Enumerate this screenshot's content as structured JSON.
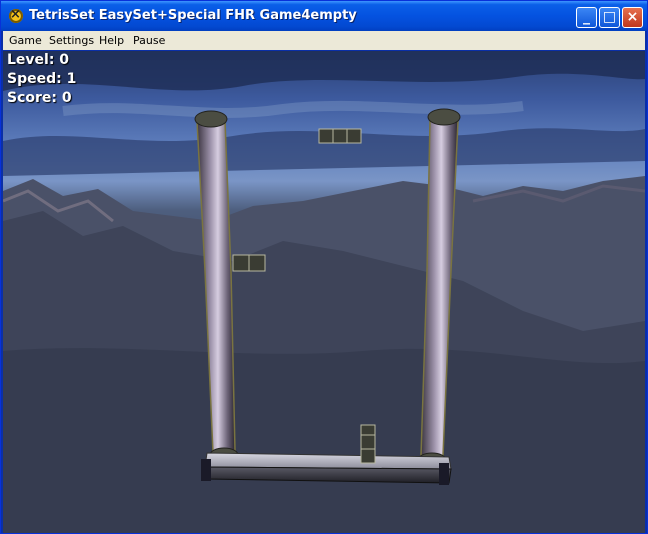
{
  "window": {
    "title": "TetrisSet EasySet+Special FHR Game4empty"
  },
  "menu": {
    "items": [
      "Game",
      "Settings",
      "Help",
      "Pause"
    ]
  },
  "hud": {
    "level": "Level: 0",
    "speed": "Speed: 1",
    "score": "Score: 0"
  },
  "colors": {
    "titlebar": "#0452e0",
    "menubar": "#ece9d8",
    "hud_text": "#ffffff",
    "close_button": "#c0361c"
  },
  "icons": [
    "app-icon",
    "minimize-icon",
    "maximize-icon",
    "close-icon"
  ]
}
